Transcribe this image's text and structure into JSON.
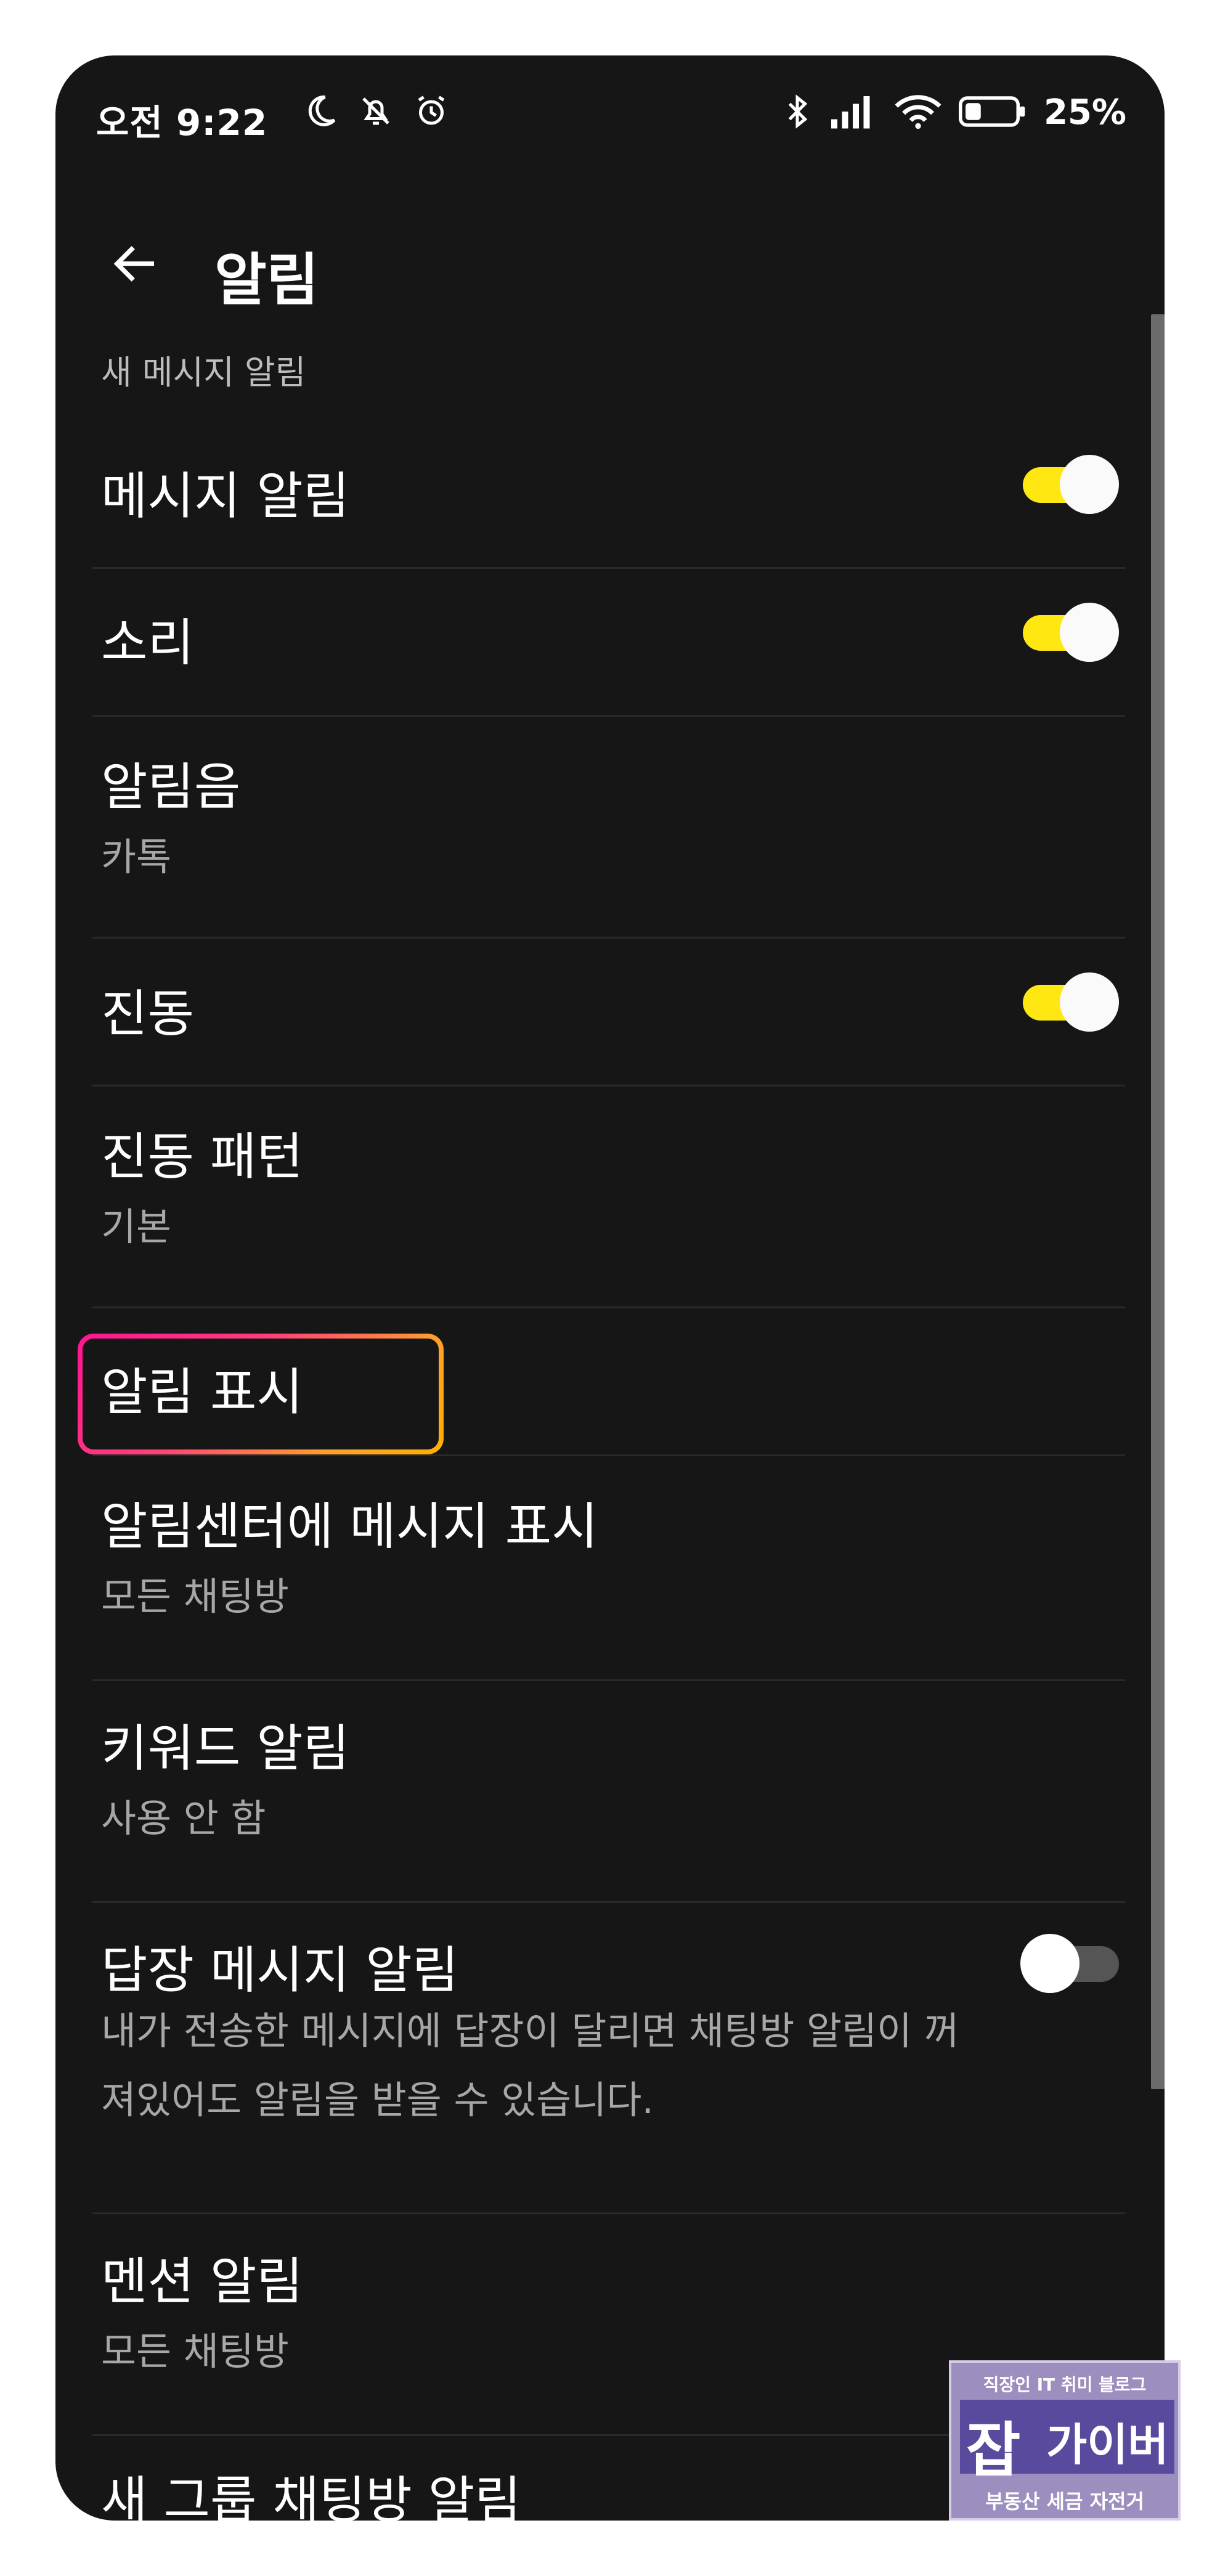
{
  "status_bar": {
    "time": "오전 9:22",
    "battery_percent": "25%",
    "icons_left": [
      "moon-icon",
      "muted-bell-icon",
      "alarm-clock-icon"
    ],
    "icons_right": [
      "bluetooth-icon",
      "signal-icon",
      "wifi-icon",
      "battery-icon"
    ]
  },
  "app_bar": {
    "title": "알림"
  },
  "section": {
    "header": "새 메시지 알림"
  },
  "rows": {
    "message_alert": {
      "title": "메시지 알림",
      "toggle_on": true
    },
    "sound": {
      "title": "소리",
      "toggle_on": true
    },
    "ringtone": {
      "title": "알림음",
      "value": "카톡"
    },
    "vibration": {
      "title": "진동",
      "toggle_on": true
    },
    "vibration_pattern": {
      "title": "진동 패턴",
      "value": "기본"
    },
    "notification_display": {
      "title": "알림 표시"
    },
    "center_display": {
      "title": "알림센터에 메시지 표시",
      "value": "모든 채팅방"
    },
    "keyword_alert": {
      "title": "키워드 알림",
      "value": "사용 안 함"
    },
    "reply_alert": {
      "title": "답장 메시지 알림",
      "toggle_on": false,
      "description_line1": "내가 전송한 메시지에 답장이 달리면 채팅방 알림이 꺼",
      "description_line2": "져있어도 알림을 받을 수 있습니다."
    },
    "mention_alert": {
      "title": "멘션 알림",
      "value": "모든 채팅방"
    },
    "new_group_alert": {
      "title": "새 그룹 채팅방 알림"
    }
  },
  "watermark": {
    "top": "직장인 IT 취미 블로그",
    "badge": "잡",
    "title": "가이버",
    "bottom": "부동산 세금 자전거"
  },
  "colors": {
    "background": "#161616",
    "toggle_on": "#ffe812",
    "highlight_gradient_start": "#ff1493",
    "highlight_gradient_end": "#ffb000"
  }
}
